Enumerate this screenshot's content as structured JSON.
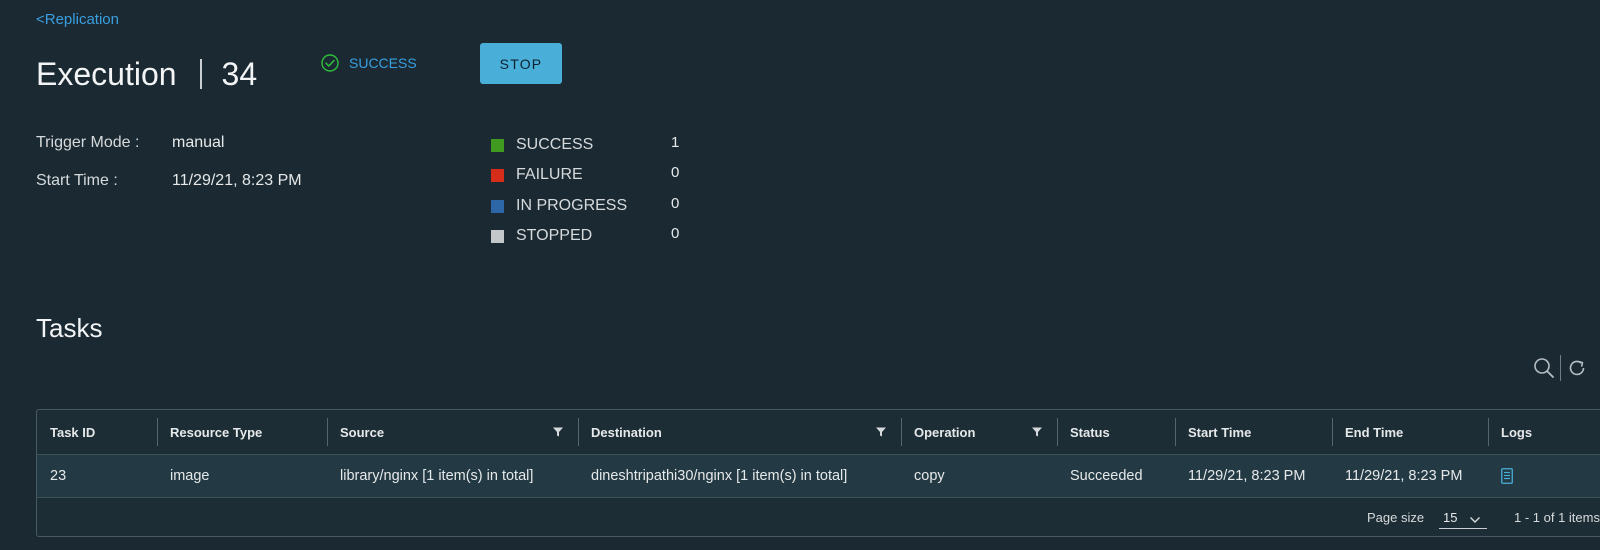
{
  "nav": {
    "back_label": "<Replication"
  },
  "header": {
    "title": "Execution",
    "execution_id": "34",
    "status": "SUCCESS",
    "stop_label": "STOP"
  },
  "info": {
    "trigger_mode_label": "Trigger Mode :",
    "trigger_mode_value": "manual",
    "start_time_label": "Start Time :",
    "start_time_value": "11/29/21, 8:23 PM"
  },
  "summary": [
    {
      "label": "SUCCESS",
      "count": "1",
      "color": "#3f9a1f"
    },
    {
      "label": "FAILURE",
      "count": "0",
      "color": "#d62c1a"
    },
    {
      "label": "IN PROGRESS",
      "count": "0",
      "color": "#2d67a8"
    },
    {
      "label": "STOPPED",
      "count": "0",
      "color": "#c4c7c9"
    }
  ],
  "tasks": {
    "title": "Tasks",
    "columns": [
      "Task ID",
      "Resource Type",
      "Source",
      "Destination",
      "Operation",
      "Status",
      "Start Time",
      "End Time",
      "Logs"
    ],
    "rows": [
      {
        "task_id": "23",
        "resource_type": "image",
        "source": "library/nginx [1 item(s) in total]",
        "destination": "dineshtripathi30/nginx [1 item(s) in total]",
        "operation": "copy",
        "status": "Succeeded",
        "start_time": "11/29/21, 8:23 PM",
        "end_time": "11/29/21, 8:23 PM",
        "logs_icon": "log-file-icon"
      }
    ],
    "footer": {
      "page_size_label": "Page size",
      "page_size_value": "15",
      "pagination_info": "1 - 1 of 1 items"
    }
  },
  "colors": {
    "accent": "#49afd9",
    "link": "#3a9ee0",
    "success_icon": "#2fbf3a",
    "background": "#1b2a32"
  }
}
